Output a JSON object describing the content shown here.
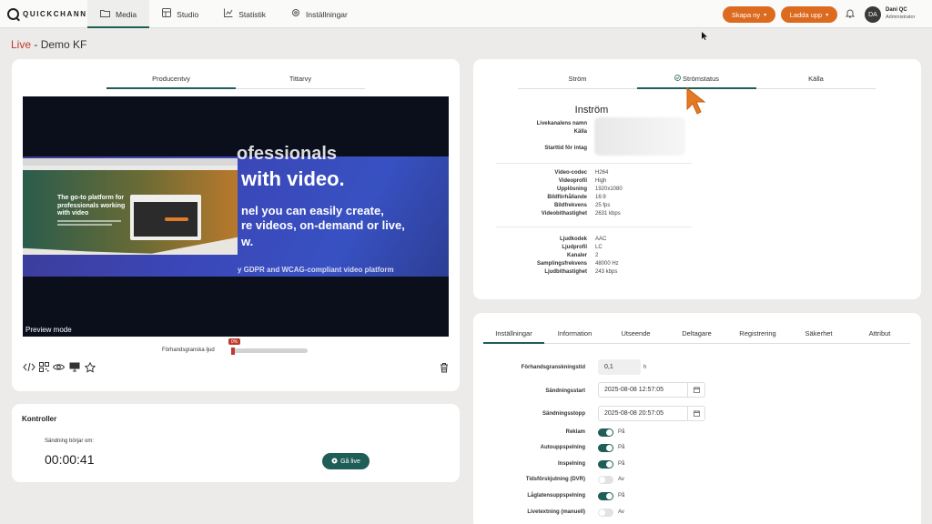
{
  "brand": {
    "name": "QUICKCHANNEL"
  },
  "nav": {
    "items": [
      {
        "label": "Media",
        "icon": "folder-icon"
      },
      {
        "label": "Studio",
        "icon": "studio-icon"
      },
      {
        "label": "Statistik",
        "icon": "chart-icon"
      },
      {
        "label": "Inställningar",
        "icon": "gear-icon"
      }
    ],
    "active": "Media"
  },
  "header_actions": {
    "create": "Skapa ny",
    "upload": "Ladda upp"
  },
  "user": {
    "initials": "DA",
    "name": "Dani QC",
    "role": "Administrator"
  },
  "page": {
    "live": "Live",
    "separator": "-",
    "title": "Demo KF"
  },
  "preview": {
    "tabs": [
      "Producentvy",
      "Tittarvy"
    ],
    "mode_label": "Preview mode",
    "promo": {
      "line1": "nel you can easily create,",
      "heading_top": "ofessionals",
      "heading": "with video.",
      "line2": "re videos, on-demand or live,",
      "line3": "w.",
      "footer": "y GDPR and WCAG-compliant video platform",
      "mock_title": "The go-to platform for professionals working with video"
    },
    "audio": {
      "label": "Förhandsgranska ljud",
      "badge": "0%",
      "level": 0
    }
  },
  "toolbar_icons": [
    "embed-code-icon",
    "qr-code-icon",
    "eye-icon",
    "monitor-icon",
    "star-icon",
    "trash-icon"
  ],
  "controls": {
    "title": "Kontroller",
    "countdown_label": "Sändning börjar om:",
    "countdown": "00:00:41",
    "go_live": "Gå live"
  },
  "stream": {
    "tabs": [
      "Ström",
      "Strömstatus",
      "Källa"
    ],
    "active_tab": "Strömstatus",
    "heading": "Inström",
    "meta_labels": [
      "Livekanalens namn",
      "Källa",
      "Starttid för intag"
    ],
    "video": [
      {
        "label": "Video-codec",
        "value": "H264"
      },
      {
        "label": "Videoprofil",
        "value": "High"
      },
      {
        "label": "Upplösning",
        "value": "1920x1080"
      },
      {
        "label": "Bildförhållande",
        "value": "16:9"
      },
      {
        "label": "Bildfrekvens",
        "value": "25 fps"
      },
      {
        "label": "Videobithastighet",
        "value": "2631 kbps"
      }
    ],
    "audio": [
      {
        "label": "Ljudkodek",
        "value": "AAC"
      },
      {
        "label": "Ljudprofil",
        "value": "LC"
      },
      {
        "label": "Kanaler",
        "value": "2"
      },
      {
        "label": "Samplingsfrekvens",
        "value": "48000 Hz"
      },
      {
        "label": "Ljudbithastighet",
        "value": "243 kbps"
      }
    ]
  },
  "settings": {
    "tabs": [
      "Inställningar",
      "Information",
      "Utseende",
      "Deltagare",
      "Registrering",
      "Säkerhet",
      "Attribut"
    ],
    "active_tab": "Inställningar",
    "preview_time": {
      "label": "Förhandsgranskningstid",
      "value": "0,1",
      "unit": "h"
    },
    "start": {
      "label": "Sändningsstart",
      "value": "2025-08-08 12:57:05"
    },
    "stop": {
      "label": "Sändningsstopp",
      "value": "2025-08-08 20:57:05"
    },
    "toggles": [
      {
        "label": "Reklam",
        "state": "På",
        "on": true
      },
      {
        "label": "Autouppspelning",
        "state": "På",
        "on": true
      },
      {
        "label": "Inspelning",
        "state": "På",
        "on": true
      },
      {
        "label": "Tidsförskjutning (DVR)",
        "state": "Av",
        "on": false
      },
      {
        "label": "Låglatensuppspelning",
        "state": "På",
        "on": true
      },
      {
        "label": "Livetextning (manuell)",
        "state": "Av",
        "on": false
      }
    ]
  },
  "colors": {
    "accent": "#1f5d57",
    "orange": "#dc6a1f",
    "live": "#c0392b"
  }
}
